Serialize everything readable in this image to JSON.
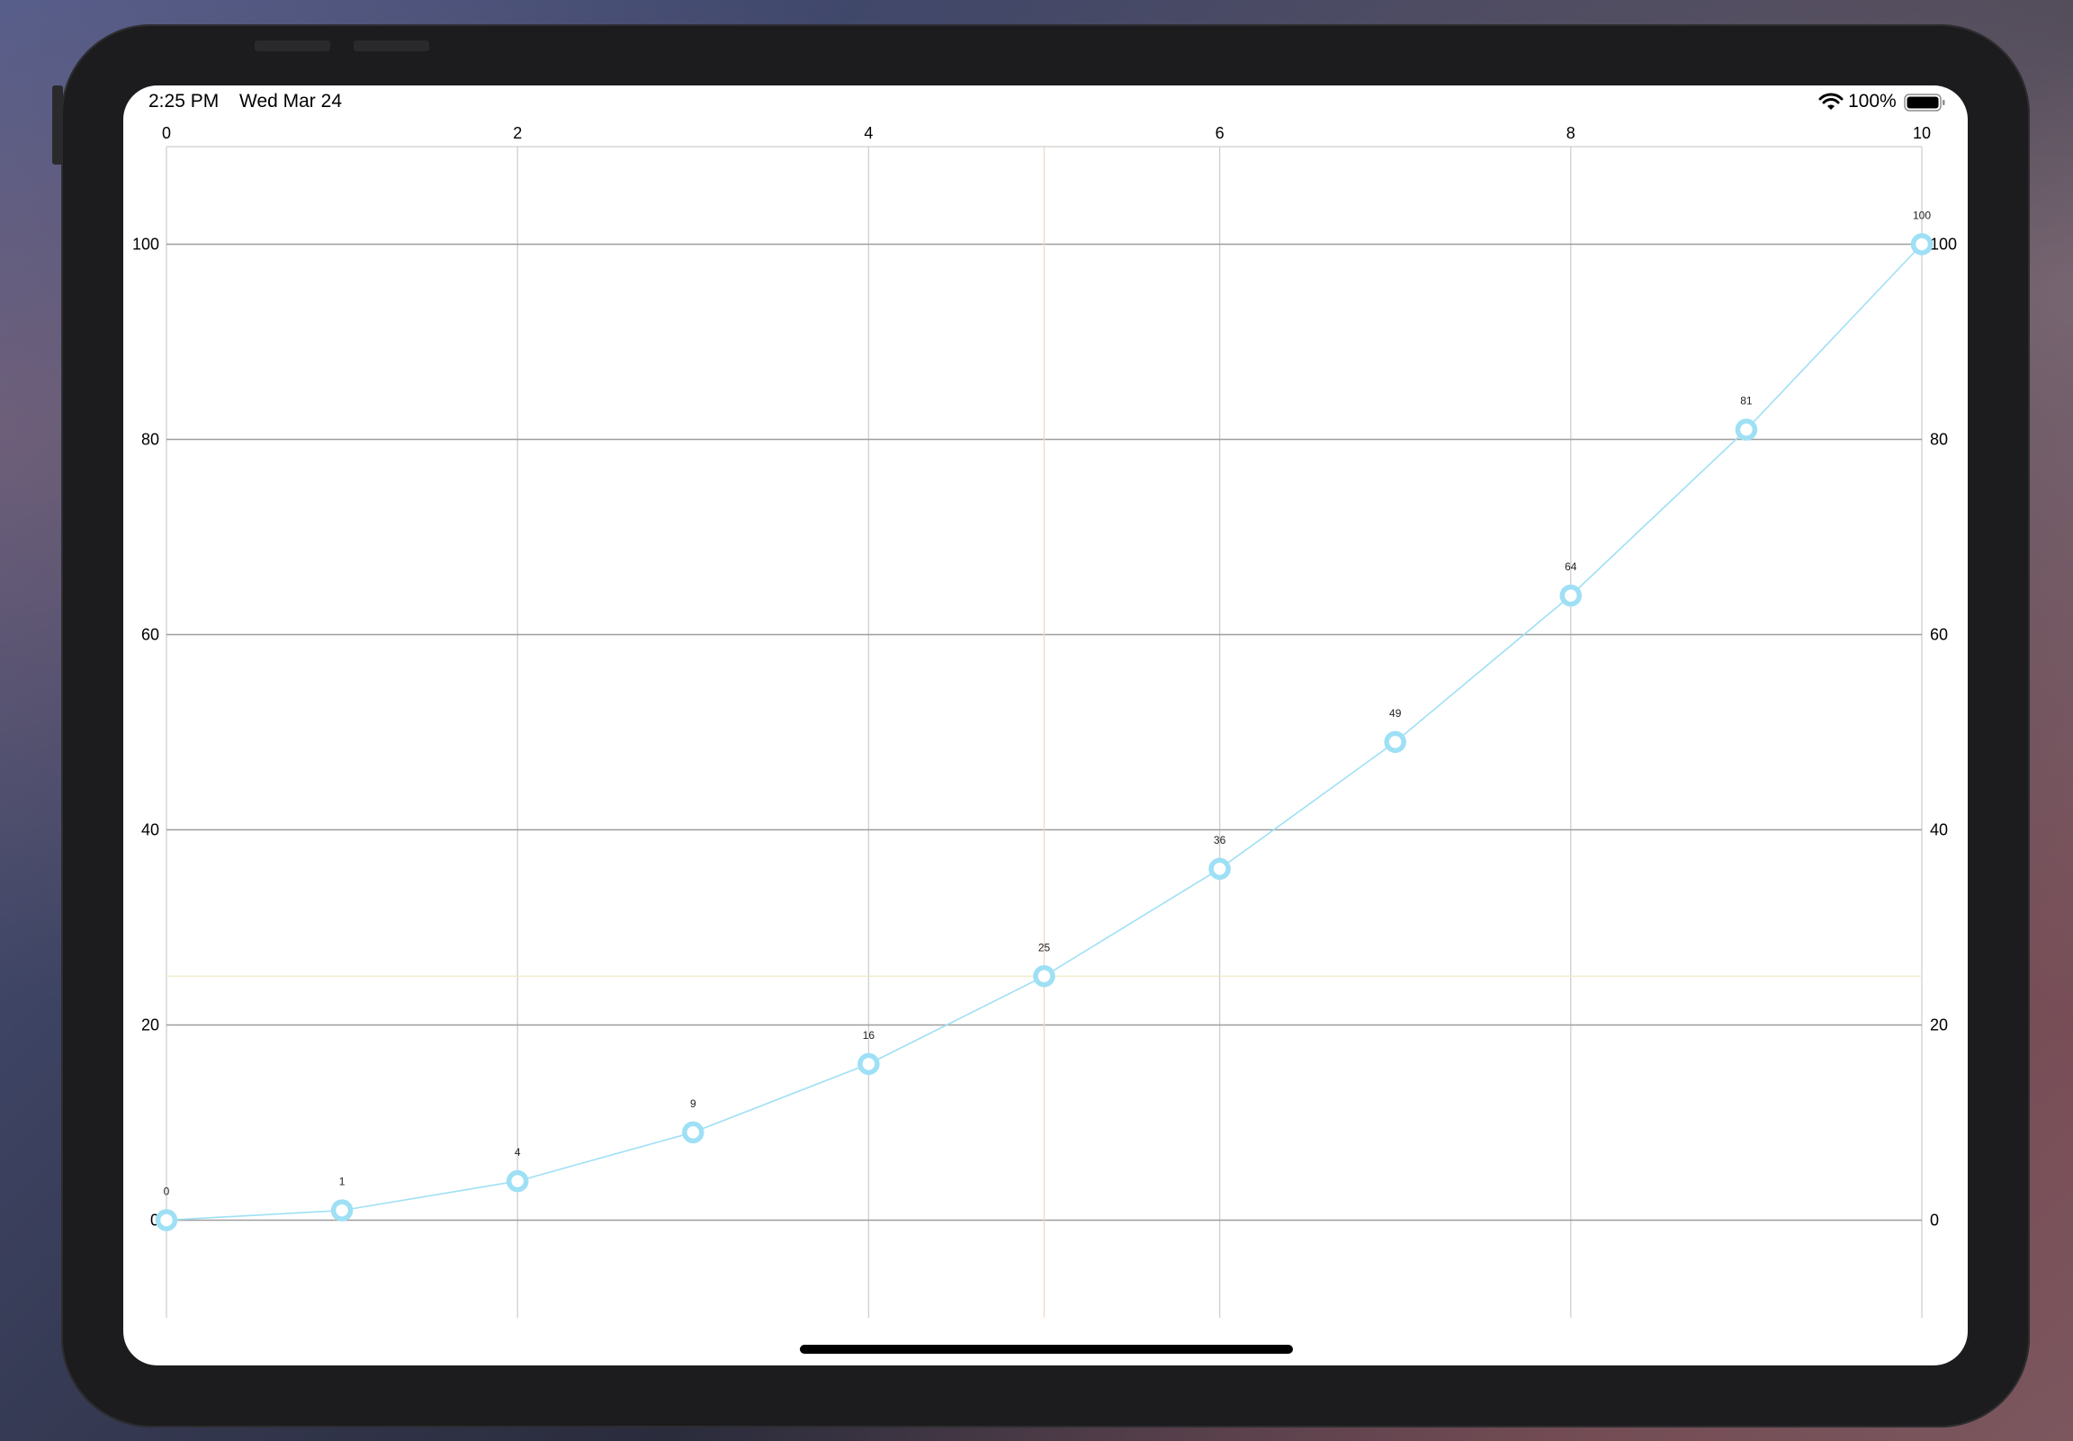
{
  "status_bar": {
    "time": "2:25 PM",
    "date": "Wed Mar 24",
    "battery_percent": "100%",
    "icons": [
      "wifi-icon",
      "battery-icon"
    ]
  },
  "colors": {
    "series": "#9ee0f5",
    "grid": "#9e9e9e",
    "minor_grid": "#cfcfcf",
    "highlight_vertical": "#eed9c9",
    "highlight_horizontal": "#eeeac2",
    "text": "#000000"
  },
  "chart_data": {
    "type": "line",
    "title": "",
    "xlabel": "",
    "ylabel": "",
    "xlim": [
      0,
      10
    ],
    "ylim": [
      -10,
      110
    ],
    "x_ticks": [
      0,
      2,
      4,
      6,
      8,
      10
    ],
    "x_tick_labels": [
      "0",
      "2",
      "4",
      "6",
      "8",
      "10"
    ],
    "x_axis_position": "top",
    "y_ticks": [
      0,
      20,
      40,
      60,
      80,
      100
    ],
    "y_tick_labels": [
      "0",
      "20",
      "40",
      "60",
      "80",
      "100"
    ],
    "y_axis_position": "both",
    "grid": true,
    "highlight": {
      "x": 5,
      "y": 25
    },
    "series": [
      {
        "x": [
          0,
          1,
          2,
          3,
          4,
          5,
          6,
          7,
          8,
          9,
          10
        ],
        "values": [
          0,
          1,
          4,
          9,
          16,
          25,
          36,
          49,
          64,
          81,
          100
        ],
        "data_labels": [
          "0",
          "1",
          "4",
          "9",
          "16",
          "25",
          "36",
          "49",
          "64",
          "81",
          "100"
        ],
        "marker": "hollow-circle"
      }
    ]
  }
}
